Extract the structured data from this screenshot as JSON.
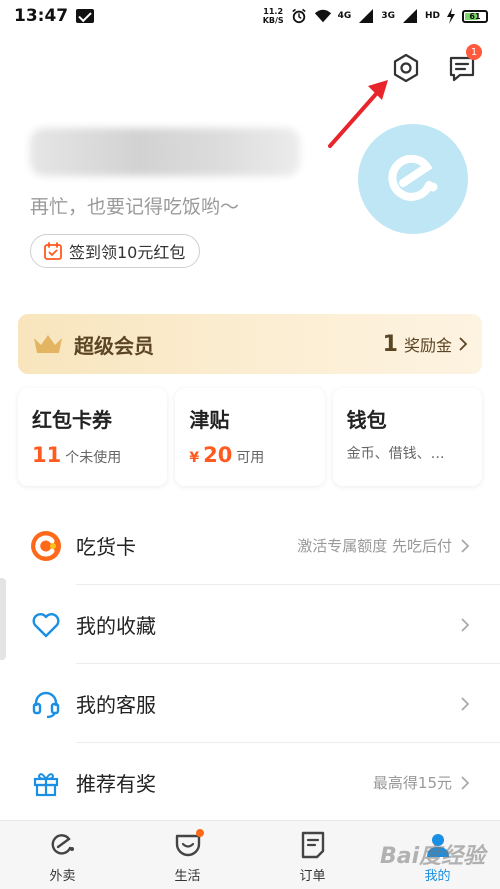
{
  "status_bar": {
    "time": "13:47",
    "net_speed_value": "11.2",
    "net_speed_unit": "KB/S",
    "signal1_label": "4G",
    "signal2_label": "3G",
    "hd_label": "HD",
    "battery_level": "61"
  },
  "header": {
    "message_badge": "1"
  },
  "profile": {
    "greeting": "再忙，也要记得吃饭哟～",
    "checkin_label": "签到领10元红包"
  },
  "vip": {
    "title": "超级会员",
    "count": "1",
    "label": "奖励金"
  },
  "cards": [
    {
      "title": "红包卡券",
      "number": "11",
      "unit": "个未使用"
    },
    {
      "title": "津贴",
      "yen": "¥",
      "number": "20",
      "unit": "可用"
    },
    {
      "title": "钱包",
      "subtitle": "金币、借钱、…"
    }
  ],
  "list": [
    {
      "label": "吃货卡",
      "right": "激活专属额度  先吃后付",
      "icon": "foodie-card-icon"
    },
    {
      "label": "我的收藏",
      "right": "",
      "icon": "heart-icon"
    },
    {
      "label": "我的客服",
      "right": "",
      "icon": "headset-icon"
    },
    {
      "label": "推荐有奖",
      "right": "最高得15元",
      "icon": "gift-icon"
    }
  ],
  "bottom_nav": [
    {
      "label": "外卖",
      "icon": "eleme-icon"
    },
    {
      "label": "生活",
      "icon": "life-icon"
    },
    {
      "label": "订单",
      "icon": "order-icon"
    },
    {
      "label": "我的",
      "icon": "profile-icon"
    }
  ],
  "watermark": "Bai度经验",
  "colors": {
    "accent": "#1a8fe3",
    "orange": "#ff5a1f",
    "vip_text": "#5b4524",
    "vip_bg": "#f8e5bd",
    "arrow": "#e8252a"
  }
}
